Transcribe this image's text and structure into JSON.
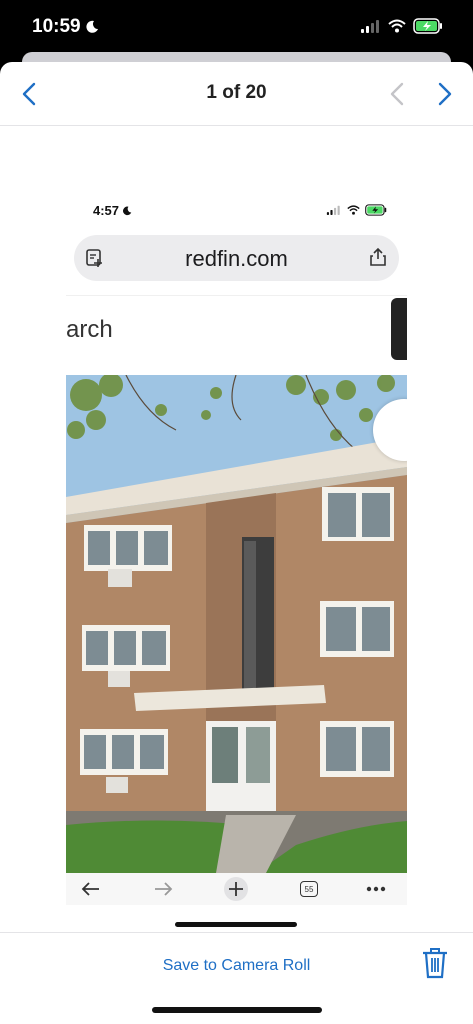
{
  "status_bar": {
    "time": "10:59"
  },
  "nav": {
    "title": "1 of 20"
  },
  "screenshot": {
    "status_time": "4:57",
    "url": "redfin.com",
    "search_fragment": "arch",
    "tabs_count": "55"
  },
  "bottom": {
    "save_label": "Save to Camera Roll"
  },
  "colors": {
    "accent": "#1f6fc5",
    "brick": "#b08766",
    "sky": "#9ec4e3",
    "grass": "#4f8a35"
  }
}
